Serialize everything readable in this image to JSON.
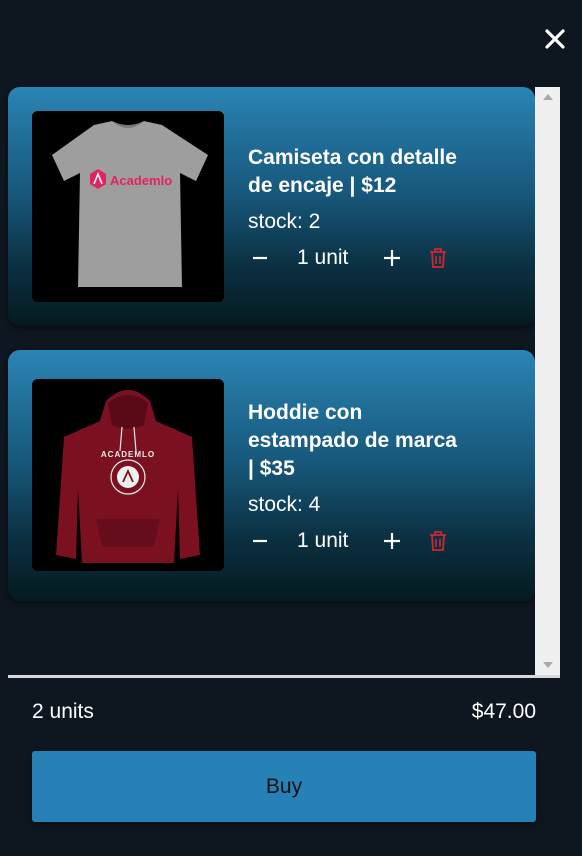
{
  "cart": {
    "close_icon": "close-icon",
    "items": [
      {
        "title_lines": [
          "Camiseta con detalle",
          "de encaje | $12"
        ],
        "stock": "stock: 2",
        "quantity": "1 unit",
        "image": "tshirt-image",
        "image_logo_text": "Academlo"
      },
      {
        "title_lines": [
          "Hoddie con",
          "estampado de marca",
          "| $35"
        ],
        "stock": "stock: 4",
        "quantity": "1 unit",
        "image": "hoodie-image",
        "image_logo_text": "ACADEMLO"
      }
    ],
    "summary": {
      "units": "2 units",
      "total": "$47.00"
    },
    "buy_label": "Buy"
  },
  "colors": {
    "background": "#0e1620",
    "card_top": "#2a84b4",
    "card_bottom": "#041a1f",
    "buy_button": "#2682b6",
    "trash_icon": "#d0262f",
    "tshirt_logo": "#e0245e"
  }
}
